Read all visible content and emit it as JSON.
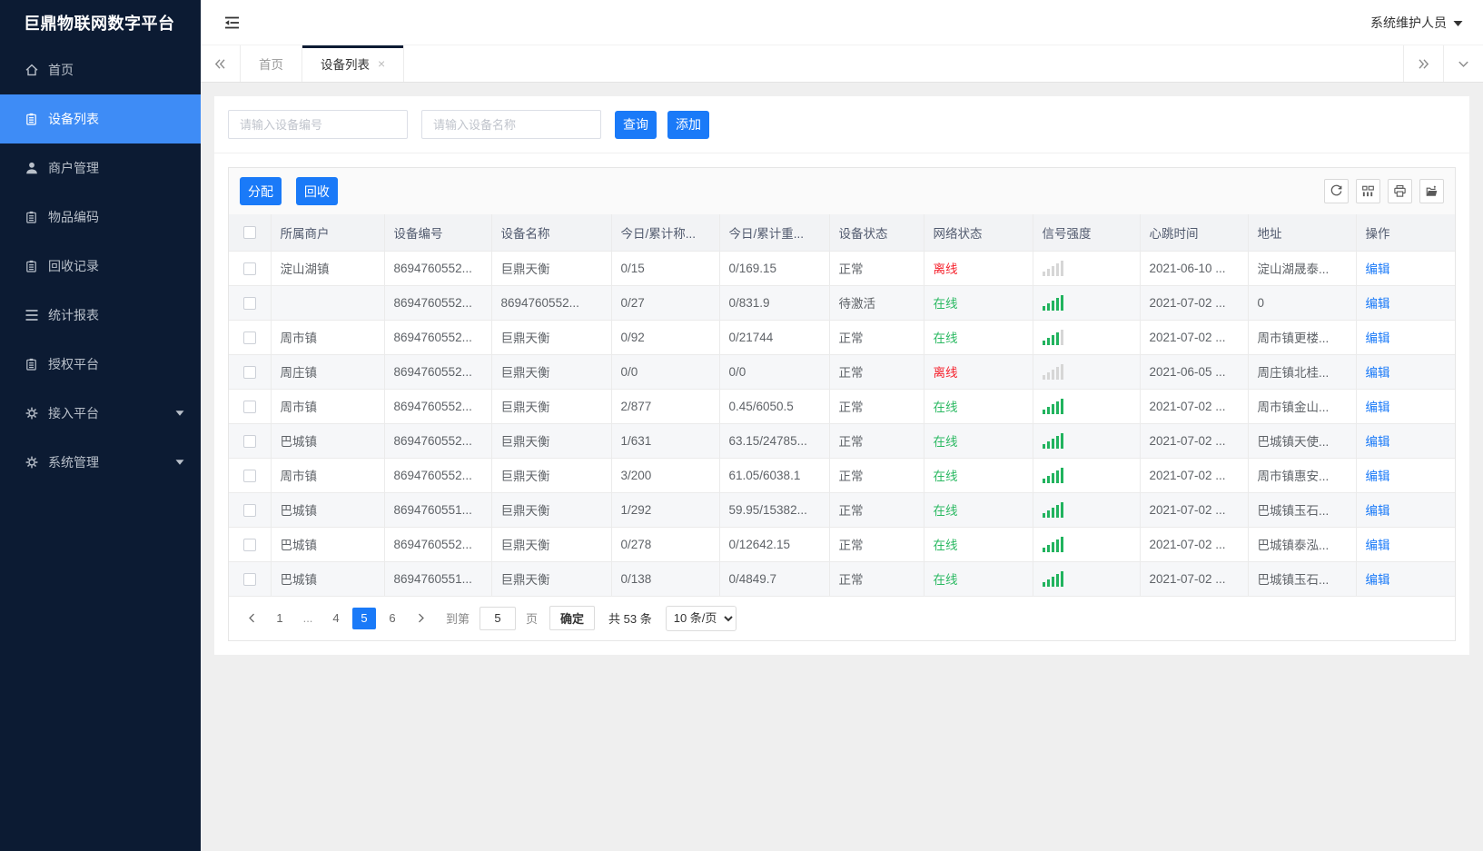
{
  "colors": {
    "sidebar_bg": "#0c1b33",
    "sidebar_active": "#3e8cf6",
    "primary_blue": "#1a7af8",
    "online_green": "#2bb962",
    "offline_red": "#f5222d",
    "signal_green": "#21b35e"
  },
  "app": {
    "logo": "巨鼎物联网数字平台",
    "user": "系统维护人员"
  },
  "sidebar": {
    "items": [
      {
        "label": "首页",
        "icon": "home-icon",
        "active": false,
        "caret": false
      },
      {
        "label": "设备列表",
        "icon": "list-icon",
        "active": true,
        "caret": false
      },
      {
        "label": "商户管理",
        "icon": "user-icon",
        "active": false,
        "caret": false
      },
      {
        "label": "物品编码",
        "icon": "clipboard-icon",
        "active": false,
        "caret": false
      },
      {
        "label": "回收记录",
        "icon": "clipboard-icon",
        "active": false,
        "caret": false
      },
      {
        "label": "统计报表",
        "icon": "lines-icon",
        "active": false,
        "caret": false
      },
      {
        "label": "授权平台",
        "icon": "clipboard-icon",
        "active": false,
        "caret": false
      },
      {
        "label": "接入平台",
        "icon": "gear-icon",
        "active": false,
        "caret": true
      },
      {
        "label": "系统管理",
        "icon": "gear-icon",
        "active": false,
        "caret": true
      }
    ]
  },
  "tabs": {
    "items": [
      {
        "label": "首页",
        "active": false,
        "closable": false
      },
      {
        "label": "设备列表",
        "active": true,
        "closable": true
      }
    ]
  },
  "search": {
    "device_no_placeholder": "请输入设备编号",
    "device_name_placeholder": "请输入设备名称",
    "query_label": "查询",
    "add_label": "添加"
  },
  "toolbar": {
    "assign_label": "分配",
    "recycle_label": "回收",
    "icons": [
      "refresh-icon",
      "columns-icon",
      "print-icon",
      "export-icon"
    ]
  },
  "table": {
    "columns": [
      "所属商户",
      "设备编号",
      "设备名称",
      "今日/累计称...",
      "今日/累计重...",
      "设备状态",
      "网络状态",
      "信号强度",
      "心跳时间",
      "地址",
      "操作"
    ],
    "rows": [
      {
        "merchant": "淀山湖镇",
        "device_no": "8694760552...",
        "device_name": "巨鼎天衡",
        "count": "0/15",
        "weight": "0/169.15",
        "device_status": "正常",
        "network_status": "离线",
        "network_state": "offline",
        "signal": 0,
        "heartbeat": "2021-06-10 ...",
        "address": "淀山湖晟泰...",
        "action": "编辑"
      },
      {
        "merchant": "",
        "device_no": "8694760552...",
        "device_name": "8694760552...",
        "count": "0/27",
        "weight": "0/831.9",
        "device_status": "待激活",
        "network_status": "在线",
        "network_state": "online",
        "signal": 5,
        "heartbeat": "2021-07-02 ...",
        "address": "0",
        "action": "编辑"
      },
      {
        "merchant": "周市镇",
        "device_no": "8694760552...",
        "device_name": "巨鼎天衡",
        "count": "0/92",
        "weight": "0/21744",
        "device_status": "正常",
        "network_status": "在线",
        "network_state": "online",
        "signal": 4,
        "heartbeat": "2021-07-02 ...",
        "address": "周市镇更楼...",
        "action": "编辑"
      },
      {
        "merchant": "周庄镇",
        "device_no": "8694760552...",
        "device_name": "巨鼎天衡",
        "count": "0/0",
        "weight": "0/0",
        "device_status": "正常",
        "network_status": "离线",
        "network_state": "offline",
        "signal": 0,
        "heartbeat": "2021-06-05 ...",
        "address": "周庄镇北桂...",
        "action": "编辑"
      },
      {
        "merchant": "周市镇",
        "device_no": "8694760552...",
        "device_name": "巨鼎天衡",
        "count": "2/877",
        "weight": "0.45/6050.5",
        "device_status": "正常",
        "network_status": "在线",
        "network_state": "online",
        "signal": 5,
        "heartbeat": "2021-07-02 ...",
        "address": "周市镇金山...",
        "action": "编辑"
      },
      {
        "merchant": "巴城镇",
        "device_no": "8694760552...",
        "device_name": "巨鼎天衡",
        "count": "1/631",
        "weight": "63.15/24785...",
        "device_status": "正常",
        "network_status": "在线",
        "network_state": "online",
        "signal": 5,
        "heartbeat": "2021-07-02 ...",
        "address": "巴城镇天使...",
        "action": "编辑"
      },
      {
        "merchant": "周市镇",
        "device_no": "8694760552...",
        "device_name": "巨鼎天衡",
        "count": "3/200",
        "weight": "61.05/6038.1",
        "device_status": "正常",
        "network_status": "在线",
        "network_state": "online",
        "signal": 5,
        "heartbeat": "2021-07-02 ...",
        "address": "周市镇惠安...",
        "action": "编辑"
      },
      {
        "merchant": "巴城镇",
        "device_no": "8694760551...",
        "device_name": "巨鼎天衡",
        "count": "1/292",
        "weight": "59.95/15382...",
        "device_status": "正常",
        "network_status": "在线",
        "network_state": "online",
        "signal": 5,
        "heartbeat": "2021-07-02 ...",
        "address": "巴城镇玉石...",
        "action": "编辑"
      },
      {
        "merchant": "巴城镇",
        "device_no": "8694760552...",
        "device_name": "巨鼎天衡",
        "count": "0/278",
        "weight": "0/12642.15",
        "device_status": "正常",
        "network_status": "在线",
        "network_state": "online",
        "signal": 5,
        "heartbeat": "2021-07-02 ...",
        "address": "巴城镇泰泓...",
        "action": "编辑"
      },
      {
        "merchant": "巴城镇",
        "device_no": "8694760551...",
        "device_name": "巨鼎天衡",
        "count": "0/138",
        "weight": "0/4849.7",
        "device_status": "正常",
        "network_status": "在线",
        "network_state": "online",
        "signal": 5,
        "heartbeat": "2021-07-02 ...",
        "address": "巴城镇玉石...",
        "action": "编辑"
      }
    ]
  },
  "pagination": {
    "pages": [
      "1",
      "...",
      "4",
      "5",
      "6"
    ],
    "active": "5",
    "goto_label": "到第",
    "goto_value": "5",
    "page_unit": "页",
    "confirm_label": "确定",
    "total_label": "共 53 条",
    "page_size": "10 条/页"
  }
}
